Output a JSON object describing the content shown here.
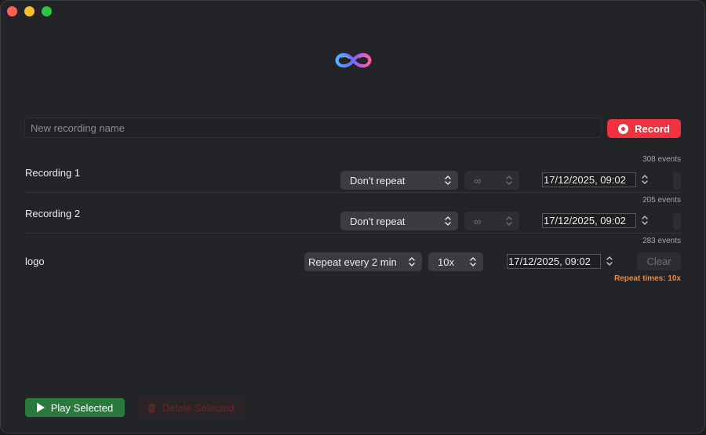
{
  "window": {
    "controls": [
      "close",
      "minimize",
      "maximize"
    ]
  },
  "logo": {
    "icon": "infinity-logo-icon"
  },
  "new_recording": {
    "placeholder": "New recording name",
    "value": "",
    "record_label": "Record",
    "record_color": "#f0323f"
  },
  "recordings": [
    {
      "name": "Recording 1",
      "events": "308 events",
      "repeat": "Don't repeat",
      "times": "∞",
      "times_enabled": false,
      "datetime": "17/12/2025, 09:02"
    },
    {
      "name": "Recording 2",
      "events": "205 events",
      "repeat": "Don't repeat",
      "times": "∞",
      "times_enabled": false,
      "datetime": "17/12/2025, 09:02"
    },
    {
      "name": "logo",
      "events": "283 events",
      "repeat": "Repeat every 2 min",
      "times": "10x",
      "times_enabled": true,
      "datetime": "17/12/2025, 09:02",
      "clear_label": "Clear",
      "note": "Repeat times: 10x"
    }
  ],
  "footer": {
    "play_label": "Play Selected",
    "delete_label": "Delete Selected",
    "play_color": "#2a7a3e"
  }
}
